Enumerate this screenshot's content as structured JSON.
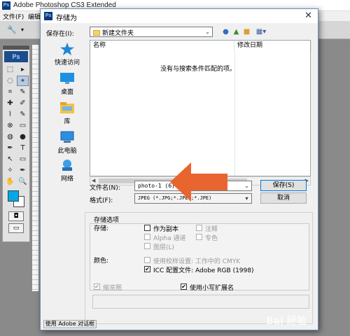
{
  "photoshop": {
    "title": "Adobe Photoshop CS3 Extended",
    "logo": "Ps",
    "menu": [
      "文件(F)",
      "编辑"
    ]
  },
  "toolbox": {
    "logo": "Ps",
    "tools": [
      "⬚",
      "▸",
      "◌",
      "⌖",
      "⌗",
      "✎",
      "✚",
      "✐",
      "⌇",
      "✎",
      "⊗",
      "▭",
      "◍",
      "●",
      "✒",
      "T",
      "↖",
      "▭",
      "✧",
      "✒",
      "✋",
      "🔍"
    ],
    "fg_color": "#00a8e8",
    "bg_color": "#ffffff",
    "mode_icons": [
      "quick-mask-icon",
      "screen-mode-icon"
    ]
  },
  "dialog": {
    "title": "存储为",
    "save_in_label": "保存在(I):",
    "save_in_value": "新建文件夹",
    "nav_icons": [
      "back-icon",
      "up-folder-icon",
      "new-folder-icon",
      "view-menu-icon"
    ],
    "places": [
      {
        "label": "快速访问",
        "icon": "star-icon"
      },
      {
        "label": "桌面",
        "icon": "desktop-icon"
      },
      {
        "label": "库",
        "icon": "library-icon"
      },
      {
        "label": "此电脑",
        "icon": "computer-icon"
      },
      {
        "label": "网络",
        "icon": "network-icon"
      }
    ],
    "columns": [
      "名称",
      "修改日期"
    ],
    "empty_message": "没有与搜索条件匹配的项。",
    "filename_label": "文件名(N):",
    "filename_value": "photo-1 (6)",
    "format_label": "格式(F):",
    "format_value": "JPEG (*.JPG;*.JPEG;*.JPE)",
    "save_button": "保存(S)",
    "cancel_button": "取消",
    "options": {
      "section_title": "存储选项",
      "store_label": "存储:",
      "as_copy": "作为副本",
      "annotations": "注释",
      "alpha_channels": "Alpha 通道",
      "spot_colors": "专色",
      "layers": "图层(L)",
      "color_label": "颜色:",
      "use_proof": "使用校样设置: 工作中的 CMYK",
      "icc_profile": "ICC 配置文件: Adobe RGB (1998)",
      "thumbnail": "缩览图",
      "lowercase_ext": "使用小写扩展名"
    },
    "use_adobe_dialog": "使用 Adobe 对话框"
  },
  "annotation": {
    "arrow_color": "#e9652f"
  },
  "watermark": "Bai 经验"
}
